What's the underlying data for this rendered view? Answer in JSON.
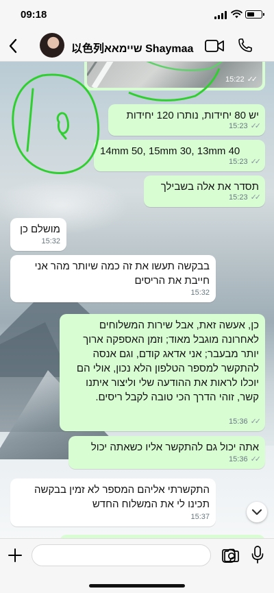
{
  "status_bar": {
    "time": "09:18",
    "battery_level": 0.55
  },
  "header": {
    "contact_name": "以色列שיימאא Shaymaa",
    "back_icon": "chevron-left-icon",
    "video_icon": "video-camera-icon",
    "call_icon": "phone-icon"
  },
  "messages": [
    {
      "type": "image",
      "direction": "out",
      "time": "15:22",
      "status": "read"
    },
    {
      "direction": "out",
      "text": "יש 80 יחידות, נותרו 120 יחידות",
      "time": "15:23",
      "status": "read"
    },
    {
      "direction": "out",
      "text": "14mm 50,  15mm 30, 13mm 40",
      "time": "15:23",
      "status": "read"
    },
    {
      "direction": "out",
      "text": "תסדר את אלה בשבילך",
      "time": "15:23",
      "status": "read"
    },
    {
      "direction": "in",
      "text": "מושלם כן",
      "time": "15:32"
    },
    {
      "direction": "in",
      "text": "בבקשה תעשו את זה כמה שיותר מהר אני חייבת את הריסים",
      "time": "15:32"
    },
    {
      "direction": "out",
      "text": "כן, אעשה זאת, אבל שירות המשלוחים לאחרונה מוגבל מאוד; וזמן האספקה ארוך יותר מבעבר; אני אדאג קודם, וגם אנסה להתקשר למספר הטלפון הלא נכון, אולי הם יוכלו לראות את ההודעה שלי וליצור איתנו קשר, זוהי הדרך הכי טובה לקבל ריסים.",
      "time": "15:36",
      "status": "read"
    },
    {
      "direction": "out",
      "text": "אתה יכול גם להתקשר אליו כשאתה יכול",
      "time": "15:36",
      "status": "read"
    },
    {
      "direction": "in",
      "text": "התקשרתי אליהם המספר לא זמין בבקשה תכינו לי את המשלוח החדש",
      "time": "15:37"
    }
  ],
  "composer": {
    "placeholder": "",
    "plus_icon": "plus-icon",
    "sticker_icon": "sticker-icon",
    "camera_icon": "camera-icon",
    "mic_icon": "microphone-icon"
  },
  "colors": {
    "outgoing_bubble": "#d9fdd3",
    "incoming_bubble": "#ffffff",
    "annotation_stroke": "#2fcf2f",
    "timestamp": "#667781"
  }
}
